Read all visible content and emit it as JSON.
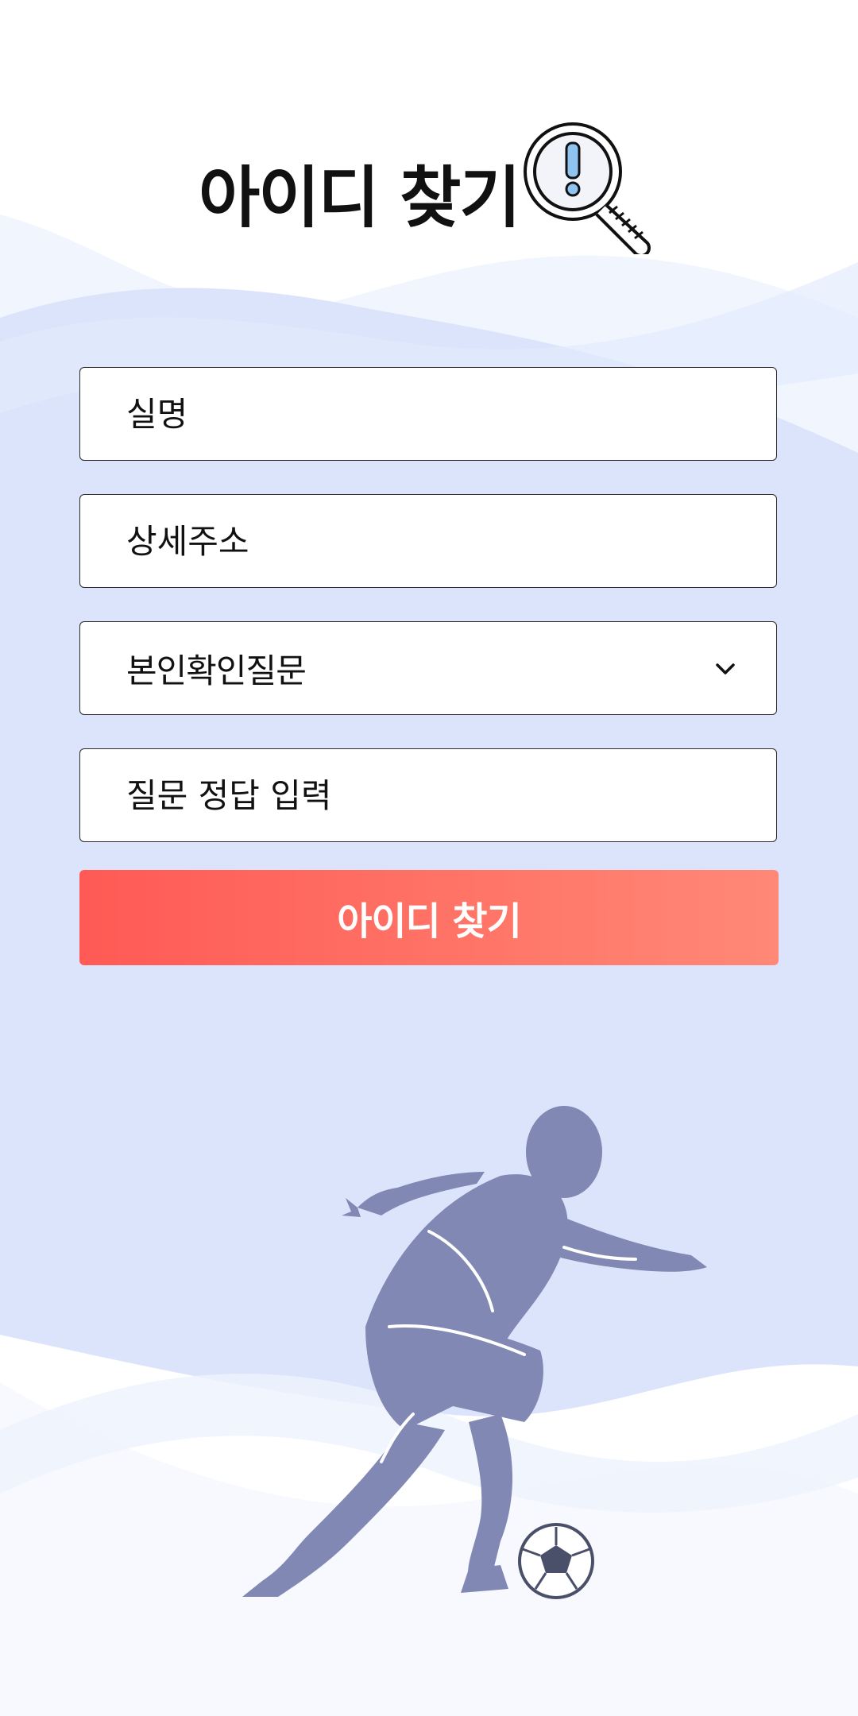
{
  "header": {
    "title": "아이디 찾기",
    "icon": "magnifier-exclamation-icon"
  },
  "form": {
    "name_field": {
      "placeholder": "실명",
      "value": ""
    },
    "address_field": {
      "placeholder": "상세주소",
      "value": ""
    },
    "question_select": {
      "selected": "본인확인질문",
      "icon": "chevron-down-icon"
    },
    "answer_field": {
      "placeholder": "질문 정답 입력",
      "value": ""
    },
    "submit_label": "아이디 찾기"
  },
  "colors": {
    "accent": "#ff5a55",
    "accent_end": "#ff8877",
    "background_wave": "#dbe4fb",
    "silhouette": "#8088b3"
  },
  "illustration": "soccer-player-silhouette"
}
